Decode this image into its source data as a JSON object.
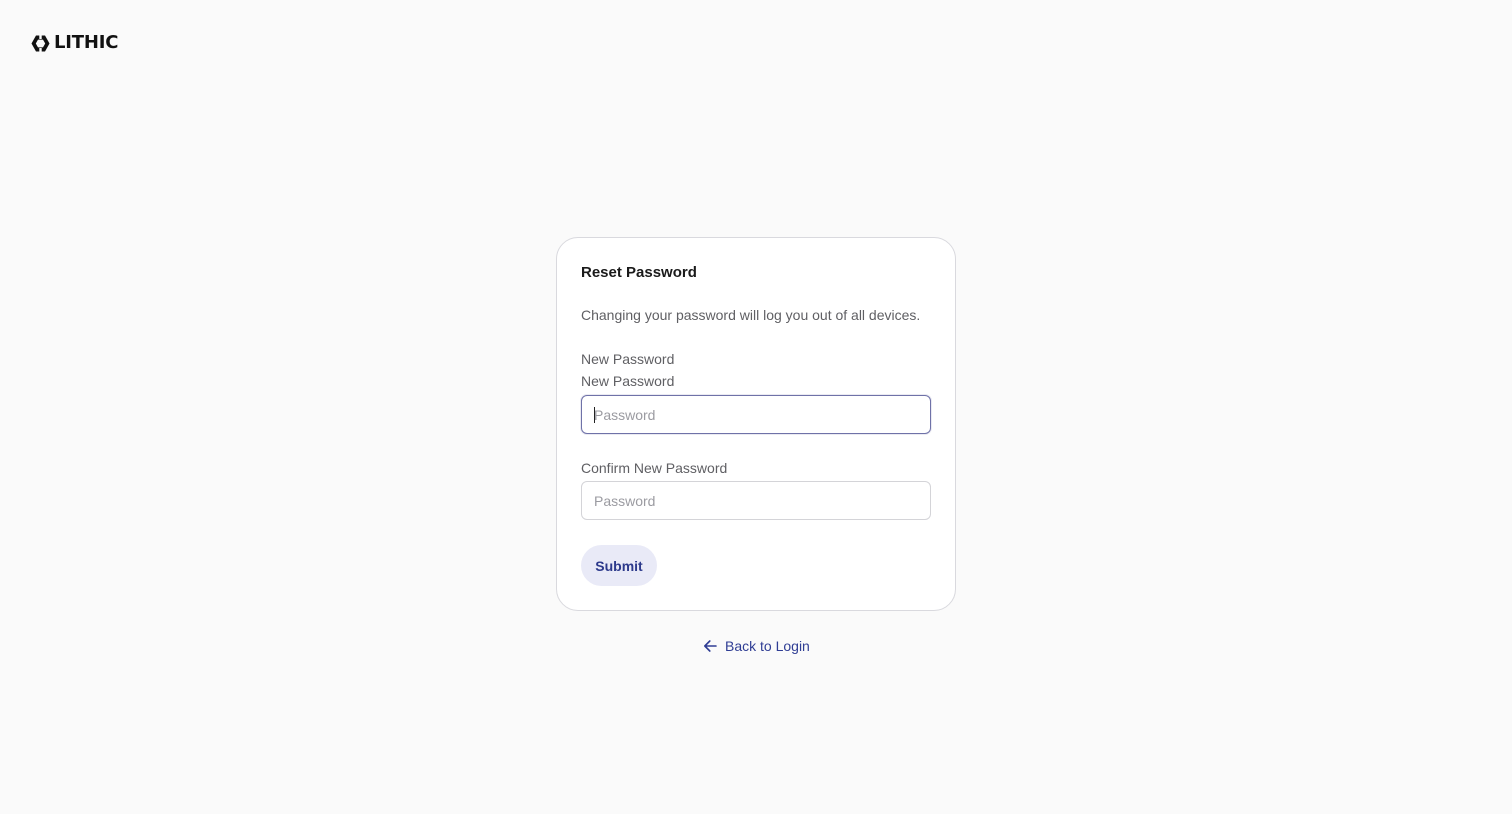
{
  "brand": {
    "name": "LITHIC",
    "logo_icon": "lithic-mark-icon",
    "color": "#111111"
  },
  "reset_card": {
    "title": "Reset Password",
    "description": "Changing your password will log you out of all devices.",
    "group_label": "New Password",
    "new_password": {
      "label": "New Password",
      "placeholder": "Password",
      "value": ""
    },
    "confirm_password": {
      "label": "Confirm New Password",
      "placeholder": "Password",
      "value": ""
    },
    "submit_label": "Submit"
  },
  "back_link": {
    "label": "Back to Login",
    "icon": "arrow-left-icon"
  },
  "colors": {
    "accent": "#2f3d94",
    "button_bg": "#e9eaf7",
    "focus_border": "#6f72a8",
    "page_bg": "#fafafa"
  }
}
